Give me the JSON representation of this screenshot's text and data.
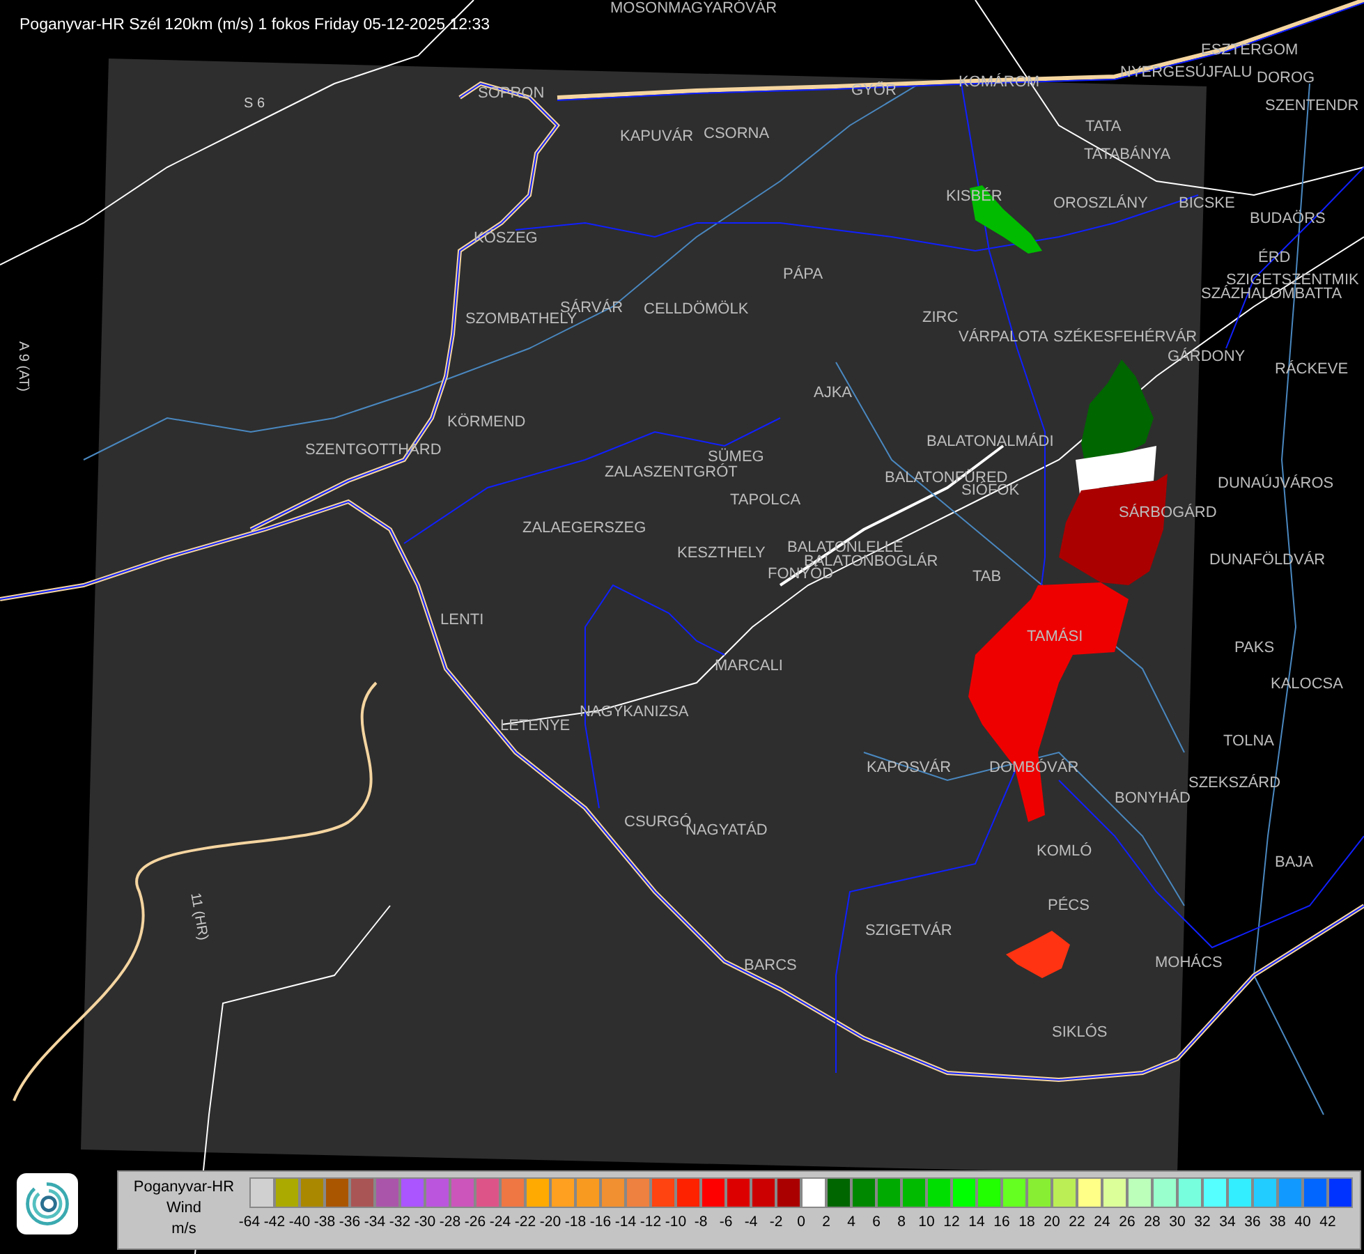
{
  "title": "Poganyvar-HR Szél 120km (m/s) 1 fokos Friday 05-12-2025 12:33",
  "cities": [
    "MOSONMAGYARÓVÁR",
    "SOPRON",
    "KAPUVÁR",
    "CSORNA",
    "GYŐR",
    "KOMÁROM",
    "ESZTERGOM",
    "NYERGESÚJFALU",
    "DOROG",
    "SZENTENDR",
    "TATA",
    "TATABÁNYA",
    "KISBÉR",
    "OROSZLÁNY",
    "BICSKE",
    "BUDAÖRS",
    "ÉRD",
    "SZIGETSZENTMIK",
    "SZÁZHALOMBATTA",
    "KŐSZEG",
    "SZOMBATHELY",
    "SÁRVÁR",
    "CELLDÖMÖLK",
    "PÁPA",
    "ZIRC",
    "VÁRPALOTA",
    "SZÉKESFEHÉRVÁR",
    "GÁRDONY",
    "RÁCKEVE",
    "AJKA",
    "KÖRMEND",
    "SZENTGOTTHÁRD",
    "BALATONALMÁDI",
    "SÜMEG",
    "ZALASZENTGRÓT",
    "TAPOLCA",
    "BALATONFÜRED",
    "SIÓFOK",
    "DUNAÚJVÁROS",
    "SÁRBOGÁRD",
    "ZALAEGERSZEG",
    "KESZTHELY",
    "BALATONLELLE",
    "BALATONBOGLÁR",
    "FONYÓD",
    "DUNAFÖLDVÁR",
    "TAB",
    "LENTI",
    "TAMÁSI",
    "PAKS",
    "MARCALI",
    "KALOCSA",
    "NAGYKANIZSA",
    "LETENYE",
    "TOLNA",
    "KAPOSVÁR",
    "DOMBÓVÁR",
    "SZEKSZÁRD",
    "BONYHÁD",
    "CSURGÓ",
    "NAGYATÁD",
    "KOMLÓ",
    "BAJA",
    "PÉCS",
    "SZIGETVÁR",
    "MOHÁCS",
    "BARCS",
    "SIKLÓS"
  ],
  "roads": [
    "S 6",
    "A 9 (AT)",
    "11 (HR)"
  ],
  "legend": {
    "title": "Poganyvar-HR",
    "quantity": "Wind",
    "unit": "m/s",
    "scale": [
      {
        "label": "-64",
        "color": "#d0d0d0"
      },
      {
        "label": "-42",
        "color": "#aaaa00"
      },
      {
        "label": "-40",
        "color": "#aa8800"
      },
      {
        "label": "-38",
        "color": "#aa5500"
      },
      {
        "label": "-36",
        "color": "#aa5555"
      },
      {
        "label": "-34",
        "color": "#aa55aa"
      },
      {
        "label": "-32",
        "color": "#aa55ff"
      },
      {
        "label": "-30",
        "color": "#bb55dd"
      },
      {
        "label": "-28",
        "color": "#cc55bb"
      },
      {
        "label": "-26",
        "color": "#dd5588"
      },
      {
        "label": "-24",
        "color": "#ee7744"
      },
      {
        "label": "-22",
        "color": "#ffaa00"
      },
      {
        "label": "-20",
        "color": "#ffa020"
      },
      {
        "label": "-18",
        "color": "#f89a20"
      },
      {
        "label": "-16",
        "color": "#f09030"
      },
      {
        "label": "-14",
        "color": "#ee8040"
      },
      {
        "label": "-12",
        "color": "#ff4411"
      },
      {
        "label": "-10",
        "color": "#ff2200"
      },
      {
        "label": "-8",
        "color": "#ff0000"
      },
      {
        "label": "-6",
        "color": "#dd0000"
      },
      {
        "label": "-4",
        "color": "#cc0000"
      },
      {
        "label": "-2",
        "color": "#aa0000"
      },
      {
        "label": "0",
        "color": "#ffffff"
      },
      {
        "label": "2",
        "color": "#006600"
      },
      {
        "label": "4",
        "color": "#008800"
      },
      {
        "label": "6",
        "color": "#00aa00"
      },
      {
        "label": "8",
        "color": "#00bb00"
      },
      {
        "label": "10",
        "color": "#00dd00"
      },
      {
        "label": "12",
        "color": "#00ff00"
      },
      {
        "label": "14",
        "color": "#22ff00"
      },
      {
        "label": "16",
        "color": "#66ff22"
      },
      {
        "label": "18",
        "color": "#88ee33"
      },
      {
        "label": "20",
        "color": "#bbee55"
      },
      {
        "label": "22",
        "color": "#ffff88"
      },
      {
        "label": "24",
        "color": "#ddff99"
      },
      {
        "label": "26",
        "color": "#bbffbb"
      },
      {
        "label": "28",
        "color": "#99ffcc"
      },
      {
        "label": "30",
        "color": "#77ffdd"
      },
      {
        "label": "32",
        "color": "#55ffff"
      },
      {
        "label": "34",
        "color": "#33eeff"
      },
      {
        "label": "36",
        "color": "#22ccff"
      },
      {
        "label": "38",
        "color": "#1199ff"
      },
      {
        "label": "40",
        "color": "#0066ff"
      },
      {
        "label": "42",
        "color": "#0033ff"
      }
    ]
  }
}
